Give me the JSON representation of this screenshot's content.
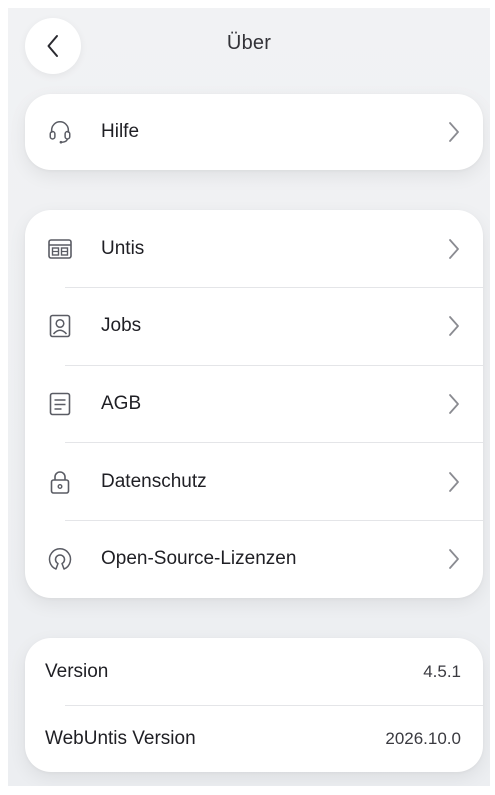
{
  "header": {
    "title": "Über",
    "back_icon": "chevron-left-icon"
  },
  "help": {
    "label": "Hilfe",
    "icon": "headset-icon"
  },
  "links": {
    "items": [
      {
        "label": "Untis",
        "icon": "untis-grid-icon"
      },
      {
        "label": "Jobs",
        "icon": "person-badge-icon"
      },
      {
        "label": "AGB",
        "icon": "document-icon"
      },
      {
        "label": "Datenschutz",
        "icon": "lock-icon"
      },
      {
        "label": "Open-Source-Lizenzen",
        "icon": "open-source-icon"
      }
    ]
  },
  "version": {
    "rows": [
      {
        "label": "Version",
        "value": "4.5.1"
      },
      {
        "label": "WebUntis Version",
        "value": "2026.10.0"
      }
    ]
  },
  "colors": {
    "background": "#eef0f2",
    "card": "#ffffff",
    "text": "#1f1f24",
    "icon": "#5a5c64",
    "chevron": "#8a8b91",
    "divider": "#e4e5e8"
  }
}
